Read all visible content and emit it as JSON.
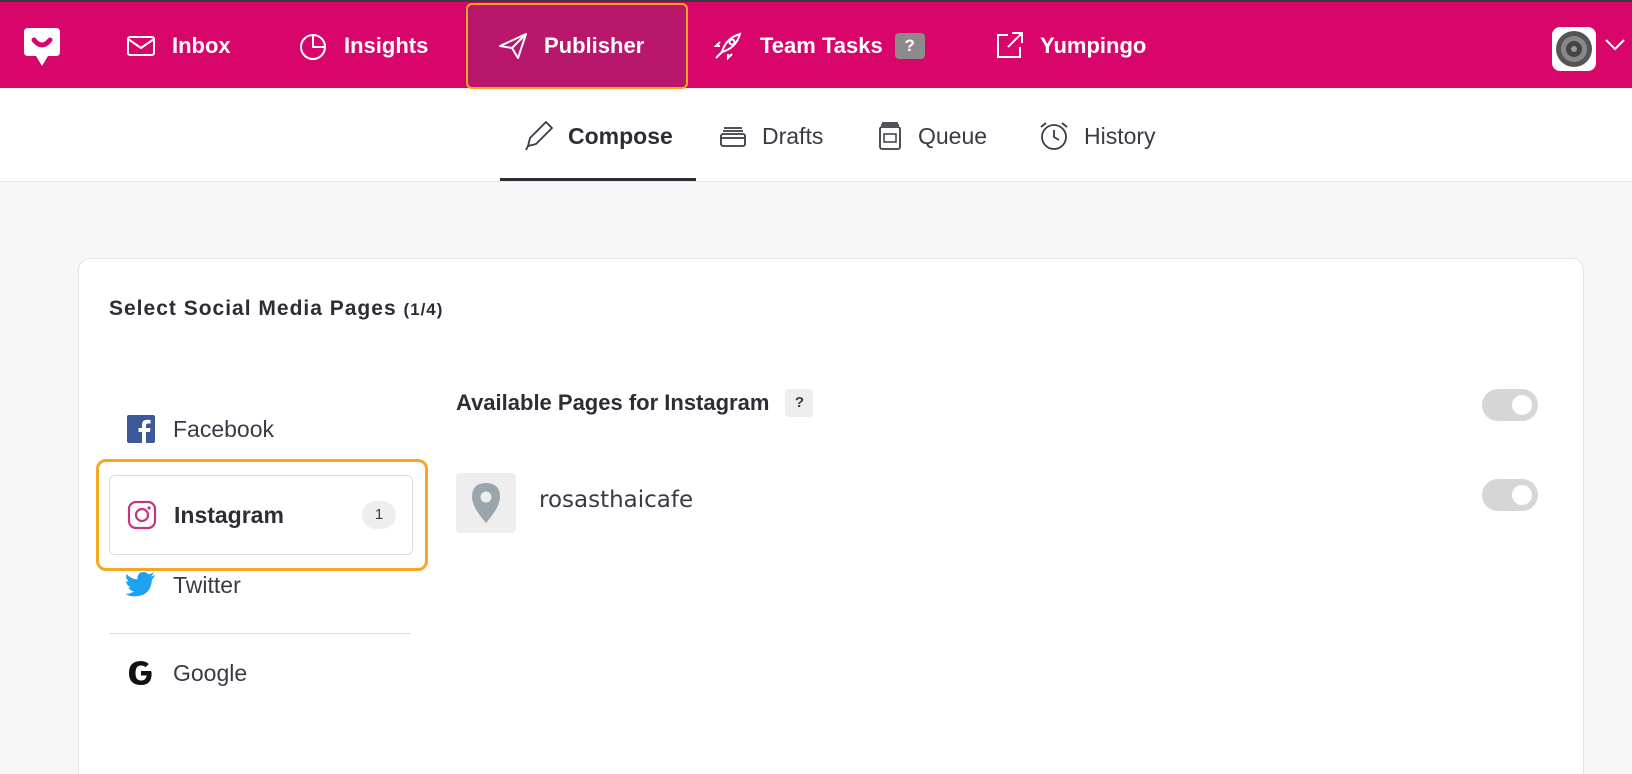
{
  "topnav": {
    "items": [
      {
        "label": "Inbox",
        "icon": "envelope-icon"
      },
      {
        "label": "Insights",
        "icon": "pie-chart-icon"
      },
      {
        "label": "Publisher",
        "icon": "paper-plane-icon"
      },
      {
        "label": "Team Tasks",
        "icon": "rocket-icon",
        "badge": "?"
      },
      {
        "label": "Yumpingo",
        "icon": "external-link-icon"
      }
    ],
    "active": "Publisher"
  },
  "subnav": {
    "items": [
      {
        "label": "Compose",
        "icon": "pencil-icon"
      },
      {
        "label": "Drafts",
        "icon": "drafts-tray-icon"
      },
      {
        "label": "Queue",
        "icon": "queue-jar-icon"
      },
      {
        "label": "History",
        "icon": "alarm-clock-icon"
      }
    ],
    "active": "Compose"
  },
  "card": {
    "title": "Select Social Media Pages",
    "count": "(1/4)",
    "networks": [
      {
        "label": "Facebook",
        "icon": "facebook-icon"
      },
      {
        "label": "Instagram",
        "icon": "instagram-icon",
        "badge": "1"
      },
      {
        "label": "Twitter",
        "icon": "twitter-icon"
      },
      {
        "label": "Google",
        "icon": "google-icon"
      }
    ],
    "available": {
      "title": "Available Pages for Instagram",
      "help": "?",
      "pages": [
        {
          "name": "rosasthaicafe",
          "icon": "location-pin-icon"
        }
      ]
    }
  },
  "colors": {
    "brand": "#d8066a",
    "highlight": "#f5a623"
  }
}
